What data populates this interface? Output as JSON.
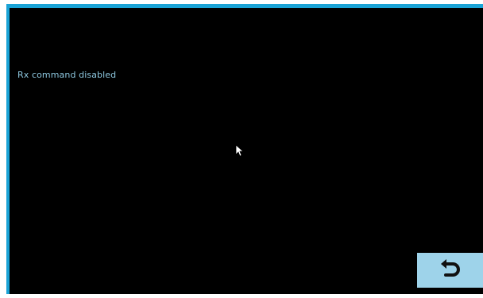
{
  "screen": {
    "status_text": "Rx command disabled"
  },
  "controls": {
    "back_icon": "undo-arrow-icon"
  },
  "colors": {
    "accent": "#1aa3d6",
    "text": "#8ec8e0",
    "button": "#9ed3ea",
    "background": "#000000"
  }
}
